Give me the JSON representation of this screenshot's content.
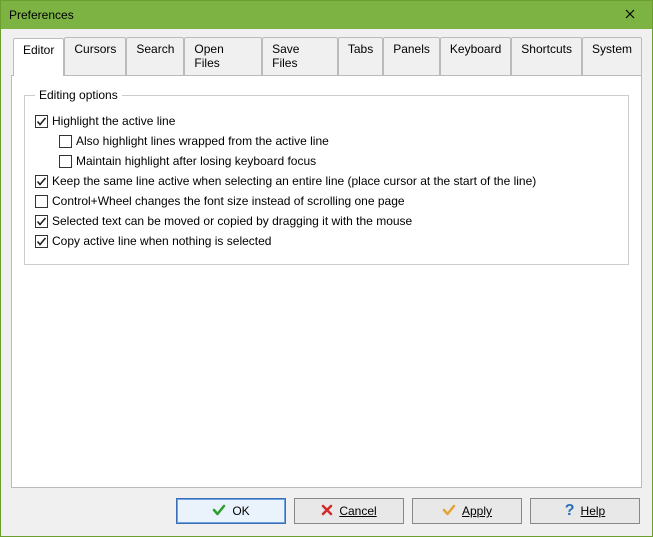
{
  "window": {
    "title": "Preferences"
  },
  "tabs": [
    {
      "label": "Editor"
    },
    {
      "label": "Cursors"
    },
    {
      "label": "Search"
    },
    {
      "label": "Open Files"
    },
    {
      "label": "Save Files"
    },
    {
      "label": "Tabs"
    },
    {
      "label": "Panels"
    },
    {
      "label": "Keyboard"
    },
    {
      "label": "Shortcuts"
    },
    {
      "label": "System"
    }
  ],
  "group": {
    "legend": "Editing options",
    "items": [
      {
        "label": "Highlight the active line",
        "checked": true,
        "indent": 0
      },
      {
        "label": "Also highlight lines wrapped from the active line",
        "checked": false,
        "indent": 1
      },
      {
        "label": "Maintain highlight after losing keyboard focus",
        "checked": false,
        "indent": 1
      },
      {
        "label": "Keep the same line active when selecting an entire line (place cursor at the start of the line)",
        "checked": true,
        "indent": 0
      },
      {
        "label": "Control+Wheel changes the font size instead of scrolling one page",
        "checked": false,
        "indent": 0
      },
      {
        "label": "Selected text can be moved or copied by dragging it with the mouse",
        "checked": true,
        "indent": 0
      },
      {
        "label": "Copy active line when nothing is selected",
        "checked": true,
        "indent": 0
      }
    ]
  },
  "buttons": {
    "ok": "OK",
    "cancel": "Cancel",
    "apply": "Apply",
    "help": "Help"
  }
}
